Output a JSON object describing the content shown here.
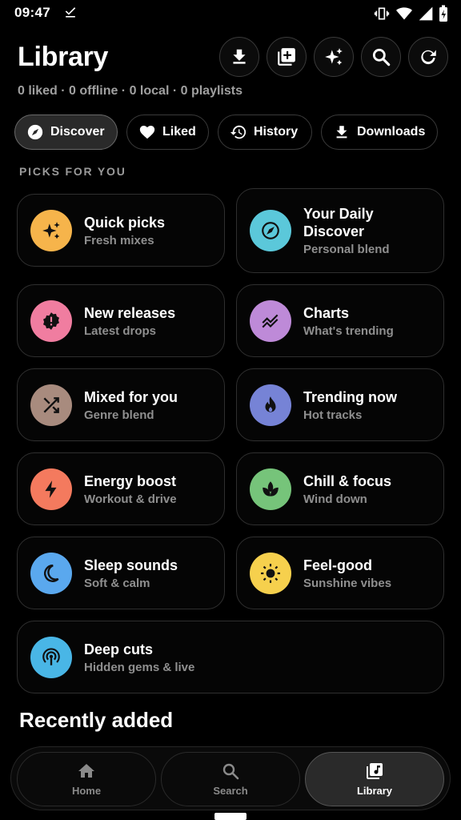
{
  "status_bar": {
    "time": "09:47"
  },
  "header": {
    "title": "Library",
    "stats": "0 liked · 0 offline · 0 local · 0 playlists",
    "buttons": [
      "download-icon",
      "add-playlist-icon",
      "sparkle-icon",
      "search-icon",
      "refresh-icon"
    ]
  },
  "chips": [
    {
      "label": "Discover",
      "icon": "compass-icon",
      "active": true
    },
    {
      "label": "Liked",
      "icon": "heart-icon"
    },
    {
      "label": "History",
      "icon": "history-icon"
    },
    {
      "label": "Downloads",
      "icon": "download-icon"
    }
  ],
  "section_title": "PICKS FOR YOU",
  "cards": [
    {
      "title": "Quick picks",
      "subtitle": "Fresh mixes",
      "icon": "sparkle-icon",
      "color": "#F6B44B"
    },
    {
      "title": "Your Daily Discover",
      "subtitle": "Personal blend",
      "icon": "compass-icon",
      "color": "#5BC8DA"
    },
    {
      "title": "New releases",
      "subtitle": "Latest drops",
      "icon": "new-badge-icon",
      "color": "#F07DA0"
    },
    {
      "title": "Charts",
      "subtitle": "What's trending",
      "icon": "trending-icon",
      "color": "#BE8AD8"
    },
    {
      "title": "Mixed for you",
      "subtitle": "Genre blend",
      "icon": "shuffle-icon",
      "color": "#A88B7E"
    },
    {
      "title": "Trending now",
      "subtitle": "Hot tracks",
      "icon": "fire-icon",
      "color": "#7683D6"
    },
    {
      "title": "Energy boost",
      "subtitle": "Workout & drive",
      "icon": "bolt-icon",
      "color": "#F47A5E"
    },
    {
      "title": "Chill & focus",
      "subtitle": "Wind down",
      "icon": "spa-icon",
      "color": "#76C47A"
    },
    {
      "title": "Sleep sounds",
      "subtitle": "Soft & calm",
      "icon": "moon-icon",
      "color": "#5AA8EE"
    },
    {
      "title": "Feel-good",
      "subtitle": "Sunshine vibes",
      "icon": "sun-icon",
      "color": "#F6D04D"
    },
    {
      "title": "Deep cuts",
      "subtitle": "Hidden gems & live",
      "icon": "podcast-icon",
      "color": "#49B6E6"
    }
  ],
  "recently_added_title": "Recently added",
  "nav": [
    {
      "label": "Home",
      "icon": "home-icon"
    },
    {
      "label": "Search",
      "icon": "search-icon"
    },
    {
      "label": "Library",
      "icon": "library-music-icon",
      "active": true
    }
  ]
}
